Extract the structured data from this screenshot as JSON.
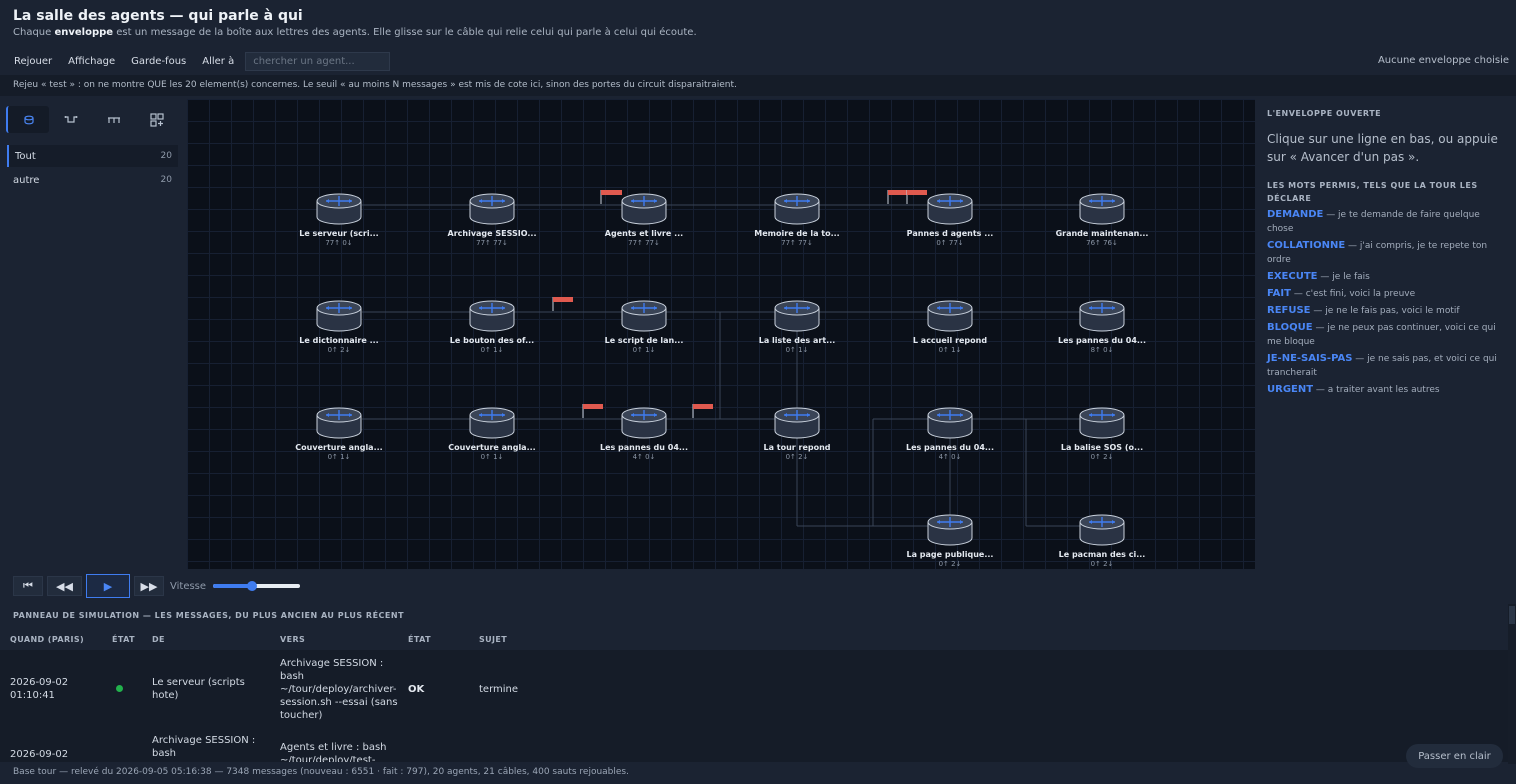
{
  "header": {
    "title": "La salle des agents — qui parle à qui",
    "subtitle_pre": "Chaque ",
    "subtitle_bold": "enveloppe",
    "subtitle_post": " est un message de la boîte aux lettres des agents. Elle glisse sur le câble qui relie celui qui parle à celui qui écoute."
  },
  "menu": {
    "items": [
      "Rejouer",
      "Affichage",
      "Garde-fous",
      "Aller à"
    ],
    "search_placeholder": "chercher un agent...",
    "right_status": "Aucune enveloppe choisie"
  },
  "notice": "Rejeu « test » : on ne montre QUE les 20 element(s) concernes. Le seuil « au moins N messages » est mis de cote ici, sinon des portes du circuit disparaitraient.",
  "sidebar": {
    "tools": [
      "agents-icon",
      "link-icon",
      "timeline-icon",
      "grid-add-icon"
    ],
    "filters": [
      {
        "label": "Tout",
        "count": "20"
      },
      {
        "label": "autre",
        "count": "20"
      }
    ]
  },
  "graph": {
    "nodes": [
      {
        "label": "Le serveur (scri...",
        "sub": "77↑ 0↓"
      },
      {
        "label": "Archivage SESSIO...",
        "sub": "77↑ 77↓"
      },
      {
        "label": "Agents et livre ...",
        "sub": "77↑ 77↓"
      },
      {
        "label": "Memoire de la to...",
        "sub": "77↑ 77↓"
      },
      {
        "label": "Pannes d agents ...",
        "sub": "0↑ 77↓"
      },
      {
        "label": "Grande maintenan...",
        "sub": "76↑ 76↓"
      },
      {
        "label": "Le dictionnaire ...",
        "sub": "0↑ 2↓"
      },
      {
        "label": "Le bouton des of...",
        "sub": "0↑ 1↓"
      },
      {
        "label": "Le script de lan...",
        "sub": "0↑ 1↓"
      },
      {
        "label": "La liste des art...",
        "sub": "0↑ 1↓"
      },
      {
        "label": "L accueil repond",
        "sub": "0↑ 1↓"
      },
      {
        "label": "Les pannes du 04...",
        "sub": "8↑ 0↓"
      },
      {
        "label": "Couverture angla...",
        "sub": "0↑ 1↓"
      },
      {
        "label": "Couverture angla...",
        "sub": "0↑ 1↓"
      },
      {
        "label": "Les pannes du 04...",
        "sub": "4↑ 0↓"
      },
      {
        "label": "La tour repond",
        "sub": "0↑ 2↓"
      },
      {
        "label": "Les pannes du 04...",
        "sub": "4↑ 0↓"
      },
      {
        "label": "La balise SOS (o...",
        "sub": "0↑ 2↓"
      },
      {
        "label": "La page publique...",
        "sub": "0↑ 2↓"
      },
      {
        "label": "Le pacman des ci...",
        "sub": "0↑ 2↓"
      }
    ]
  },
  "right_panel": {
    "heading": "L'ENVELOPPE OUVERTE",
    "hint": "Clique sur une ligne en bas, ou appuie sur « Avancer d'un pas ».",
    "words_heading": "LES MOTS PERMIS, TELS QUE LA TOUR LES DÉCLARE",
    "words": [
      {
        "word": "DEMANDE",
        "desc": " — je te demande de faire quelque chose"
      },
      {
        "word": "COLLATIONNE",
        "desc": " — j'ai compris, je te repete ton ordre"
      },
      {
        "word": "EXECUTE",
        "desc": " — je le fais"
      },
      {
        "word": "FAIT",
        "desc": " — c'est fini, voici la preuve"
      },
      {
        "word": "REFUSE",
        "desc": " — je ne le fais pas, voici le motif"
      },
      {
        "word": "BLOQUE",
        "desc": " — je ne peux pas continuer, voici ce qui me bloque"
      },
      {
        "word": "JE-NE-SAIS-PAS",
        "desc": " — je ne sais pas, et voici ce qui trancherait"
      },
      {
        "word": "URGENT",
        "desc": " — a traiter avant les autres"
      }
    ]
  },
  "controls": {
    "first": "⏮",
    "back": "◀◀",
    "play": "▶",
    "forward": "▶▶",
    "speed_label": "Vitesse",
    "speed_fraction": 0.45
  },
  "simulation": {
    "title": "PANNEAU DE SIMULATION — LES MESSAGES, DU PLUS ANCIEN AU PLUS RÉCENT",
    "columns": [
      "QUAND (PARIS)",
      "ÉTAT",
      "DE",
      "VERS",
      "ÉTAT",
      "SUJET"
    ],
    "rows": [
      {
        "when": "2026-09-02 01:10:41",
        "from": "Le serveur (scripts hote)",
        "to": "Archivage SESSION : bash ~/tour/deploy/archiver-session.sh --essai (sans toucher)",
        "status": "OK",
        "subject": "termine"
      },
      {
        "when": "2026-09-02",
        "from": "Archivage SESSION : bash",
        "to": "Agents et livre : bash ~/tour/deploy/test-",
        "status": "",
        "subject": ""
      }
    ]
  },
  "footer": "Base tour — relevé du 2026-09-05 05:16:38 — 7348 messages (nouveau : 6551 · fait : 797), 20 agents, 21 câbles, 400 sauts rejouables.",
  "clear_button": "Passer en clair",
  "colors": {
    "accent": "#3f7cf0",
    "ok_dot": "#22b14c",
    "flag": "#e05a4f",
    "canvas_bg": "#0b1019"
  }
}
